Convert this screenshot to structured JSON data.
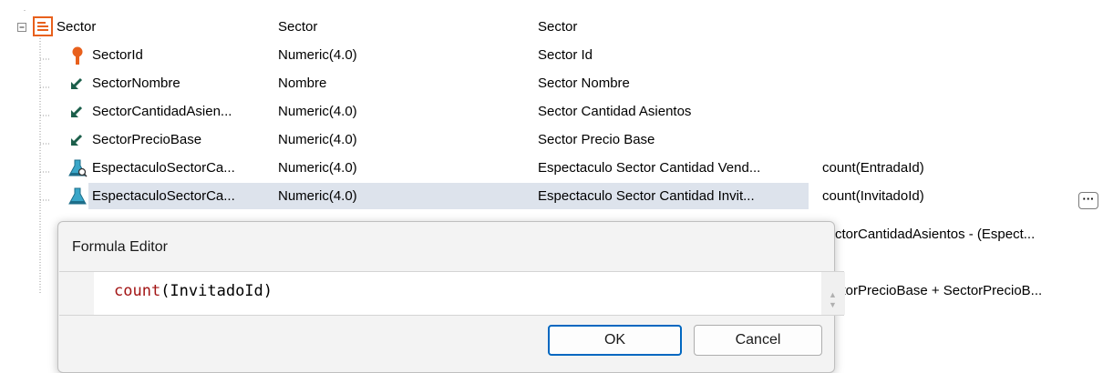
{
  "rows": [
    {
      "name": "Sector",
      "type": "Sector",
      "desc": "Sector",
      "formula": "",
      "icon": "transaction-icon"
    },
    {
      "name": "SectorId",
      "type": "Numeric(4.0)",
      "desc": "Sector Id",
      "formula": "",
      "icon": "key-icon"
    },
    {
      "name": "SectorNombre",
      "type": "Nombre",
      "desc": "Sector Nombre",
      "formula": "",
      "icon": "attribute-arrow-icon"
    },
    {
      "name": "SectorCantidadAsien...",
      "type": "Numeric(4.0)",
      "desc": "Sector Cantidad Asientos",
      "formula": "",
      "icon": "attribute-arrow-icon"
    },
    {
      "name": "SectorPrecioBase",
      "type": "Numeric(4.0)",
      "desc": "Sector Precio Base",
      "formula": "",
      "icon": "attribute-arrow-icon"
    },
    {
      "name": "EspectaculoSectorCa...",
      "type": "Numeric(4.0)",
      "desc": "Espectaculo Sector Cantidad Vend...",
      "formula": "count(EntradaId)",
      "icon": "formula-flask-search-icon"
    },
    {
      "name": "EspectaculoSectorCa...",
      "type": "Numeric(4.0)",
      "desc": "Espectaculo Sector Cantidad Invit...",
      "formula": "count(InvitadoId)",
      "icon": "formula-flask-icon"
    },
    {
      "name": "",
      "type": "",
      "desc": "",
      "formula": "ctorCantidadAsientos - (Espect...",
      "icon": ""
    },
    {
      "name": "",
      "type": "",
      "desc": "",
      "formula": "",
      "icon": ""
    },
    {
      "name": "",
      "type": "",
      "desc": "",
      "formula": "ctorPrecioBase + SectorPrecioB...",
      "icon": ""
    }
  ],
  "ellipsis_label": "···",
  "dialog": {
    "title": "Formula Editor",
    "code_fn": "count",
    "code_rest": "(InvitadoId)",
    "ok_label": "OK",
    "cancel_label": "Cancel"
  },
  "colors": {
    "selection": "#dde3ec",
    "ok_border": "#0067c0",
    "code_keyword": "#a31515"
  }
}
